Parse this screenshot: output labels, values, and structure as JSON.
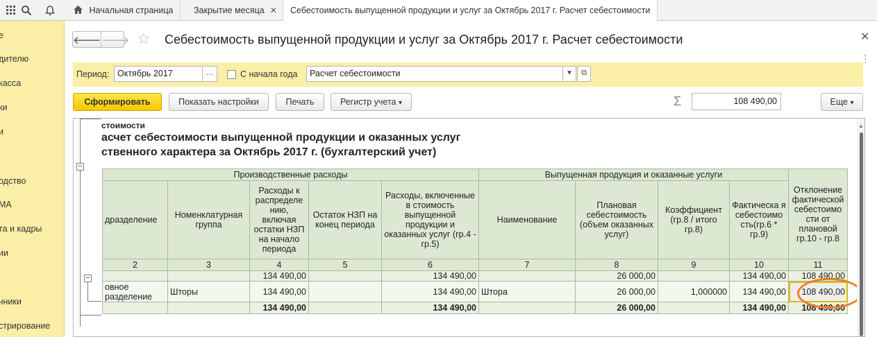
{
  "topbar": {
    "icons": [
      "grid-icon",
      "search-icon",
      "bell-icon"
    ],
    "tabs": [
      {
        "label": "Начальная страница",
        "icon": "home-icon"
      },
      {
        "label": "Закрытие месяца",
        "close": "✕"
      },
      {
        "label": "Себестоимость выпущенной продукции и услуг за Октябрь 2017 г. Расчет себестоимости",
        "active": true
      }
    ]
  },
  "sidebar": {
    "items": [
      "е",
      "дителю",
      "касса",
      "ки",
      "и",
      "одство",
      "МА",
      "та и кадры",
      "ии",
      "чники",
      "стрирование"
    ]
  },
  "form": {
    "title": "Себестоимость выпущенной продукции и услуг за Октябрь 2017 г. Расчет себестоимости",
    "period_label": "Период:",
    "period_value": "Октябрь 2017",
    "period_btn": "...",
    "from_start_label": "С начала года",
    "report_variant": "Расчет себестоимости",
    "generate_label": "Сформировать",
    "settings_label": "Показать настройки",
    "print_label": "Печать",
    "registry_label": "Регистр учета",
    "sum_symbol": "Σ",
    "sum_value": "108 490,00",
    "more_label": "Еще"
  },
  "report": {
    "subtitle": "стоимости",
    "title_line1": "асчет себестоимости выпущенной продукции и оказанных услуг",
    "title_line2": "ственного характера за Октябрь 2017 г. (бухгалтерский учет)",
    "group1": "Производственные расходы",
    "group2": "Выпущенная  продукция и оказанные услуги",
    "columns": [
      "дразделение",
      "Номенклатурная группа",
      "Расходы к распределе нию, включая остатки НЗП на начало периода",
      "Остаток НЗП на конец периода",
      "Расходы, включенные в стоимость выпущенной продукции и оказанных услуг (гр.4 - гр.5)",
      "Наименование",
      "Плановая себестоимость (объем оказанных услуг)",
      "Коэффициент (гр.8 / итого гр.8)",
      "Фактическа я себестоимо сть(гр.6 * гр.9)",
      "Отклонение фактической себестоимо сти от плановой гр.10 - гр.8"
    ],
    "col_numbers": [
      "2",
      "3",
      "4",
      "5",
      "6",
      "7",
      "8",
      "9",
      "10",
      "11"
    ],
    "total_row": [
      "",
      "",
      "134 490,00",
      "",
      "134 490,00",
      "",
      "26 000,00",
      "",
      "134 490,00",
      "108 490,00"
    ],
    "detail_row": [
      "овное разделение",
      "Шторы",
      "134 490,00",
      "",
      "134 490,00",
      "Штора",
      "26 000,00",
      "1,000000",
      "134 490,00",
      "108 490,00"
    ],
    "grand_total": [
      "",
      "",
      "134 490,00",
      "",
      "134 490,00",
      "",
      "26 000,00",
      "",
      "134 490,00",
      "108 490,00"
    ]
  },
  "colors": {
    "accent_yellow": "#fbeea6",
    "primary_button": "#f5c800",
    "table_header": "#dde8d2",
    "highlight_circle": "#ef7f22"
  }
}
